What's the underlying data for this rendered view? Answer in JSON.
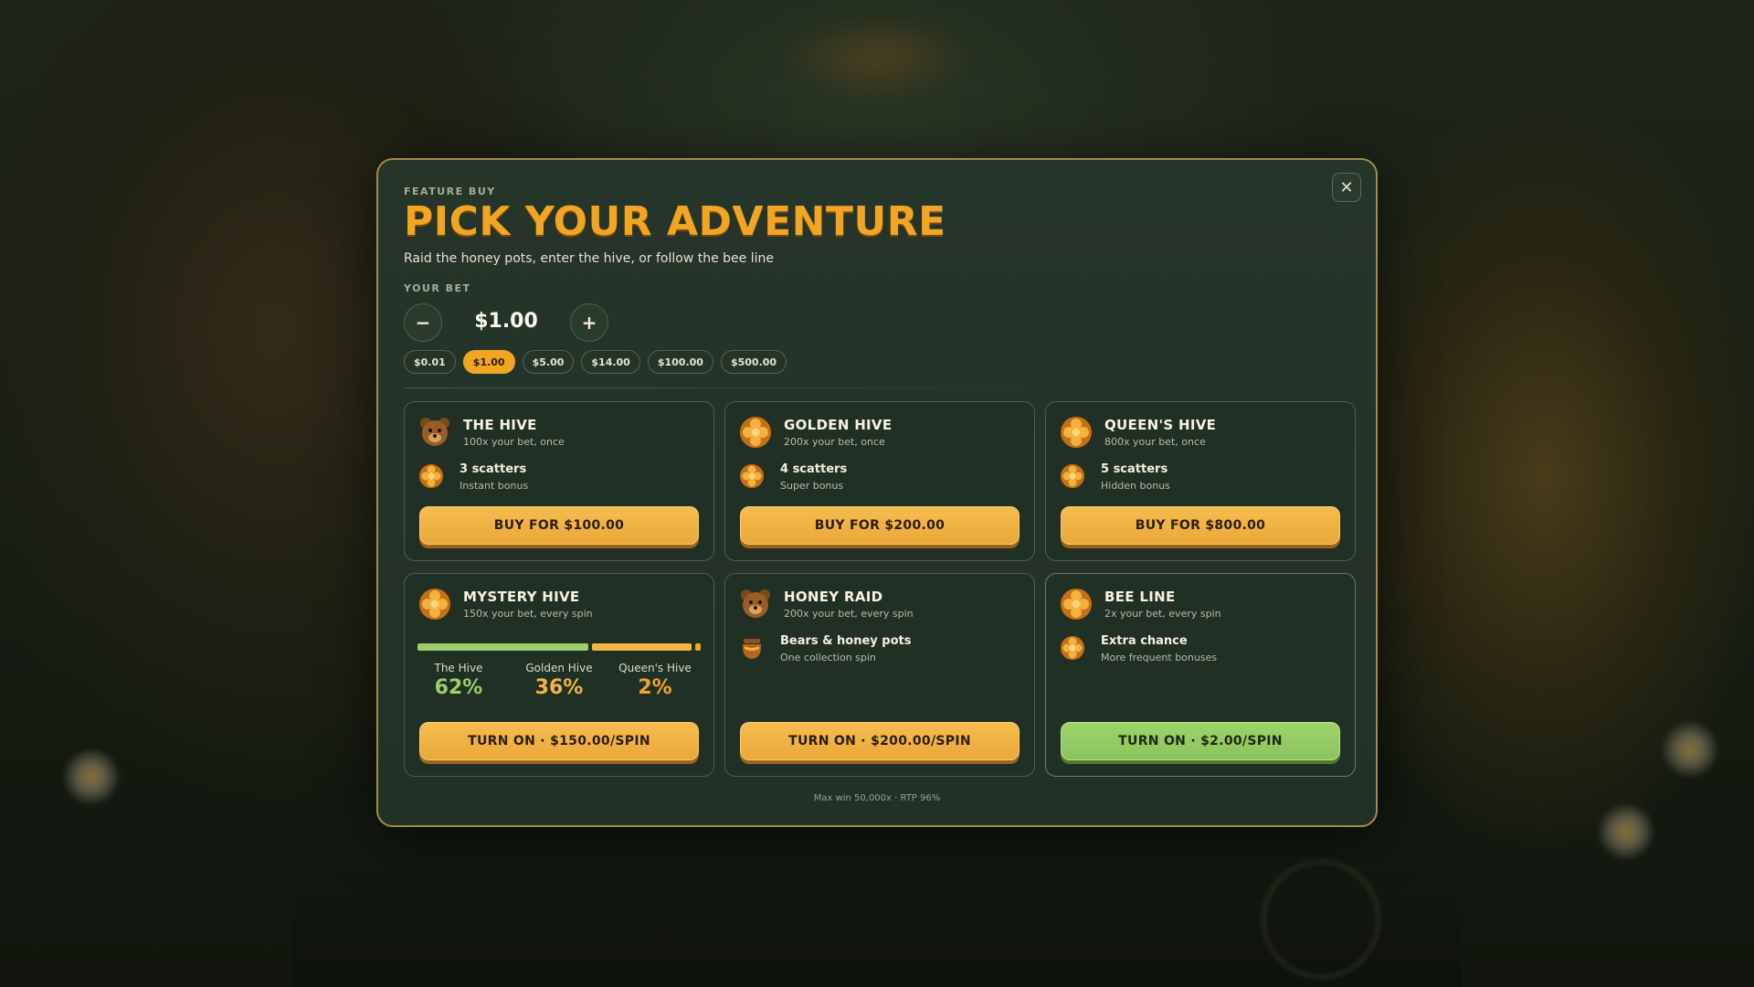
{
  "modal": {
    "eyebrow": "FEATURE BUY",
    "title": "PICK YOUR ADVENTURE",
    "subtitle": "Raid the honey pots, enter the hive, or follow the bee line",
    "close_icon": "close-icon",
    "footer": "Max win 50,000x · RTP 96%"
  },
  "bet": {
    "label": "YOUR BET",
    "value": "$1.00",
    "decrease_label": "−",
    "increase_label": "+",
    "chips": [
      "$0.01",
      "$1.00",
      "$5.00",
      "$14.00",
      "$100.00",
      "$500.00"
    ],
    "selected_chip": "$1.00"
  },
  "cards": [
    {
      "name": "THE HIVE",
      "desc": "100x your bet, once",
      "icon": "bear-icon",
      "sub_icon": "honeycomb-icon",
      "sub_title": "3 scatters",
      "sub_desc": "Instant bonus",
      "cta": "BUY FOR $100.00"
    },
    {
      "name": "GOLDEN HIVE",
      "desc": "200x your bet, once",
      "icon": "honeycomb-icon",
      "sub_icon": "honeycomb-icon",
      "sub_title": "4 scatters",
      "sub_desc": "Super bonus",
      "cta": "BUY FOR $200.00"
    },
    {
      "name": "QUEEN'S HIVE",
      "desc": "800x your bet, once",
      "icon": "honeycomb-icon",
      "sub_icon": "honeycomb-icon",
      "sub_title": "5 scatters",
      "sub_desc": "Hidden bonus",
      "cta": "BUY FOR $800.00"
    },
    {
      "name": "MYSTERY HIVE",
      "desc": "150x your bet, every spin",
      "icon": "honeycomb-icon",
      "cta": "TURN ON · $150.00/SPIN",
      "odds": [
        {
          "label": "The Hive",
          "value": "62%",
          "fraction": 0.62,
          "color": "#9ccf6a"
        },
        {
          "label": "Golden Hive",
          "value": "36%",
          "fraction": 0.36,
          "color": "#f2b640"
        },
        {
          "label": "Queen's Hive",
          "value": "2%",
          "fraction": 0.02,
          "color": "#f2a423"
        }
      ]
    },
    {
      "name": "HONEY RAID",
      "desc": "200x your bet, every spin",
      "icon": "bear-icon",
      "sub_icon": "honey-pot-icon",
      "sub_title": "Bears & honey pots",
      "sub_desc": "One collection spin",
      "cta": "TURN ON · $200.00/SPIN"
    },
    {
      "name": "BEE LINE",
      "desc": "2x your bet, every spin",
      "icon": "honeycomb-icon",
      "sub_icon": "honeycomb-icon",
      "sub_title": "Extra chance",
      "sub_desc": "More frequent bonuses",
      "cta": "TURN ON · $2.00/SPIN",
      "active": true
    }
  ],
  "colors": {
    "accent": "#f2a423",
    "cta": "#eaa83a",
    "active_cta": "#8cc35c",
    "panel": "#223126"
  }
}
